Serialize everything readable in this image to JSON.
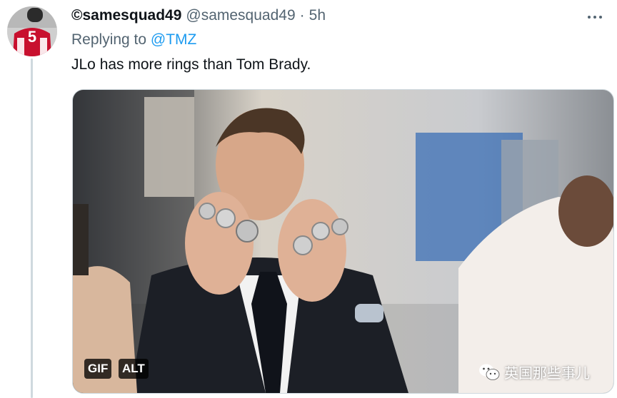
{
  "tweet": {
    "display_name": "©samesquad49",
    "handle": "@samesquad49",
    "separator": "·",
    "timestamp": "5h",
    "replying_prefix": "Replying to",
    "replying_to": "@TMZ",
    "text": "JLo has more rings than Tom Brady."
  },
  "avatar": {
    "jersey_number": "5"
  },
  "media": {
    "gif_label": "GIF",
    "alt_label": "ALT"
  },
  "watermark": {
    "text": "英国那些事儿"
  },
  "icons": {
    "more": "more-horizontal-icon",
    "watermark": "wechat-icon"
  },
  "colors": {
    "link": "#1d9bf0",
    "muted": "#536471",
    "text": "#0f1419",
    "border": "#cfd9de"
  }
}
